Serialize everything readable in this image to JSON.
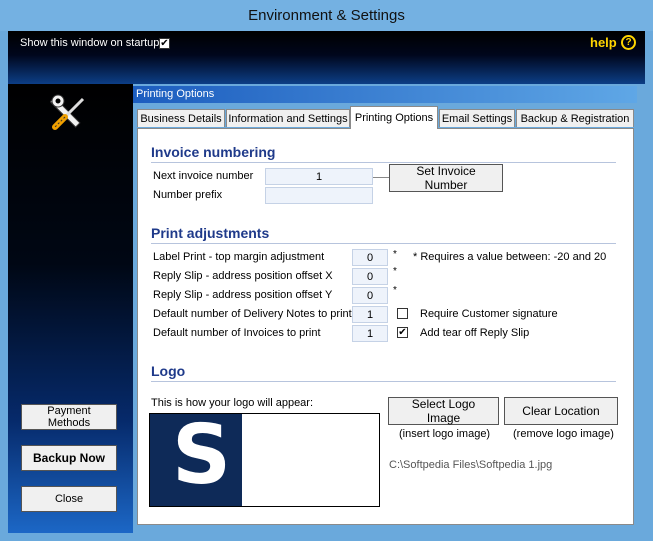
{
  "window": {
    "title": "Environment & Settings"
  },
  "header": {
    "startup_label": "Show this window on startup",
    "startup_checked": "✔",
    "help_label": "help",
    "help_icon_glyph": "?"
  },
  "sidebar": {
    "icon": "tools-icon",
    "buttons": [
      "Payment Methods",
      "Backup Now",
      "Close"
    ]
  },
  "group_label": "Printing Options",
  "tabs": [
    "Business Details",
    "Information and Settings",
    "Printing Options",
    "Email Settings",
    "Backup &  Registration"
  ],
  "active_tab": "Printing Options",
  "invoice": {
    "title": "Invoice numbering",
    "next_label": "Next invoice number",
    "next_value": "1",
    "prefix_label": "Number prefix",
    "prefix_value": "",
    "set_button": "Set Invoice Number"
  },
  "print": {
    "title": "Print adjustments",
    "rows": [
      {
        "label": "Label Print -  top margin adjustment",
        "value": "0",
        "star": "*"
      },
      {
        "label": "Reply Slip - address position offset X",
        "value": "0",
        "star": "*"
      },
      {
        "label": "Reply Slip - address position offset Y",
        "value": "0",
        "star": "*"
      },
      {
        "label": "Default number of Delivery Notes to print",
        "value": "1"
      },
      {
        "label": "Default number of Invoices to print",
        "value": "1"
      }
    ],
    "note": "* Requires a value between: -20 and 20",
    "require_signature_label": "Require Customer signature",
    "require_signature_checked": "",
    "tear_off_label": "Add tear off Reply Slip",
    "tear_off_checked": "✔"
  },
  "logo": {
    "title": "Logo",
    "caption": "This is how your logo will appear:",
    "logo_letter": "S",
    "select_button": "Select Logo Image",
    "select_caption": "(insert logo image)",
    "clear_button": "Clear Location",
    "clear_caption": "(remove logo image)",
    "path": "C:\\Softpedia Files\\Softpedia 1.jpg"
  },
  "colors": {
    "accent": "#1f3a8a",
    "help": "#ffd500",
    "logo_bg": "#0e2a58"
  }
}
